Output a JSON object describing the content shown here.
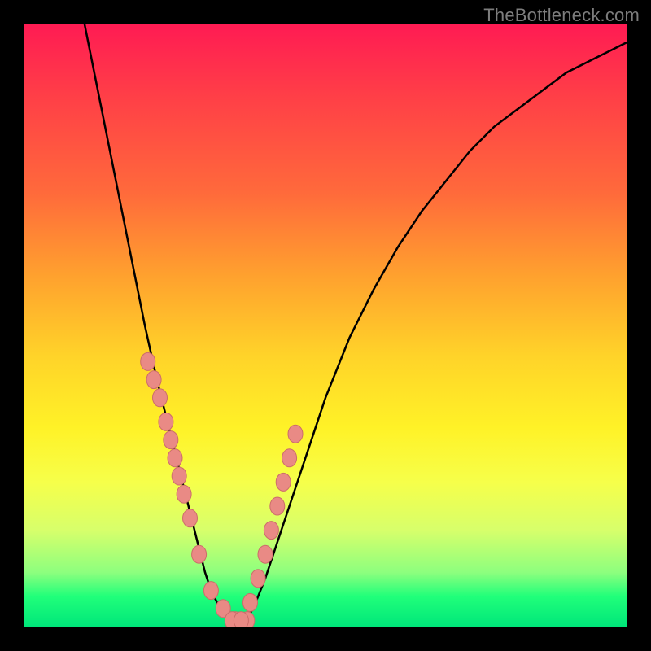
{
  "watermark": "TheBottleneck.com",
  "colors": {
    "curve": "#000000",
    "marker_fill": "#e98a85",
    "marker_stroke": "#cc6d6a"
  },
  "chart_data": {
    "type": "line",
    "title": "",
    "xlabel": "",
    "ylabel": "",
    "xlim": [
      0,
      100
    ],
    "ylim": [
      0,
      100
    ],
    "grid": false,
    "legend": false,
    "x": [
      10,
      12,
      14,
      16,
      18,
      20,
      22,
      24,
      25,
      26,
      27,
      28,
      29,
      30,
      31,
      32,
      33,
      34,
      35,
      36,
      38,
      40,
      42,
      44,
      46,
      48,
      50,
      54,
      58,
      62,
      66,
      70,
      74,
      78,
      82,
      86,
      90,
      94,
      98,
      100
    ],
    "y": [
      100,
      90,
      80,
      70,
      60,
      50,
      41,
      33,
      29,
      25,
      21,
      17,
      13,
      9,
      6,
      4,
      2,
      1,
      0,
      0,
      3,
      8,
      14,
      20,
      26,
      32,
      38,
      48,
      56,
      63,
      69,
      74,
      79,
      83,
      86,
      89,
      92,
      94,
      96,
      97
    ],
    "markers": {
      "x": [
        20.5,
        21.5,
        22.5,
        23.5,
        24.3,
        25.0,
        25.7,
        26.5,
        27.5,
        29.0,
        31.0,
        33.0,
        35.0,
        37.0,
        34.5,
        36.0,
        37.5,
        38.8,
        40.0,
        41.0,
        42.0,
        43.0,
        44.0,
        45.0
      ],
      "y": [
        44,
        41,
        38,
        34,
        31,
        28,
        25,
        22,
        18,
        12,
        6,
        3,
        1,
        1,
        1,
        1,
        4,
        8,
        12,
        16,
        20,
        24,
        28,
        32
      ]
    }
  }
}
